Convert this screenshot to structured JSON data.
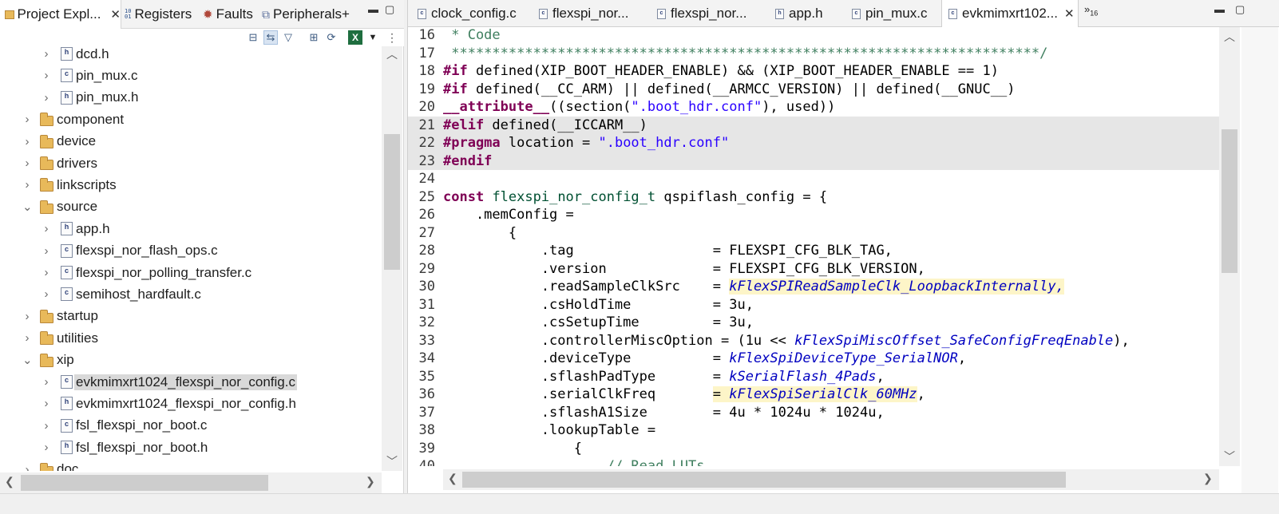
{
  "left_panel": {
    "tabs": [
      {
        "icon": "project-explorer-icon",
        "label": "Project Expl...",
        "close": "✕"
      },
      {
        "icon": "registers-icon",
        "label": "Registers"
      },
      {
        "icon": "faults-icon",
        "label": "Faults"
      },
      {
        "icon": "peripherals-icon",
        "label": "Peripherals+"
      }
    ],
    "toolbar": [
      "collapse-all-icon",
      "link-with-editor-icon",
      "filter-icon",
      "layout-icon",
      "refresh-icon",
      "excel-icon",
      "view-menu-icon",
      "more-icon"
    ],
    "tree": [
      {
        "label": "dcd.h",
        "kind": "h",
        "glyph": "h"
      },
      {
        "label": "pin_mux.c",
        "kind": "c",
        "glyph": "c"
      },
      {
        "label": "pin_mux.h",
        "kind": "h",
        "glyph": "h"
      },
      {
        "label": "component",
        "kind": "folder"
      },
      {
        "label": "device",
        "kind": "folder"
      },
      {
        "label": "drivers",
        "kind": "folder"
      },
      {
        "label": "linkscripts",
        "kind": "folder"
      },
      {
        "label": "source",
        "kind": "folder"
      },
      {
        "label": "app.h",
        "kind": "h",
        "glyph": "h"
      },
      {
        "label": "flexspi_nor_flash_ops.c",
        "kind": "c",
        "glyph": "c"
      },
      {
        "label": "flexspi_nor_polling_transfer.c",
        "kind": "c",
        "glyph": "c"
      },
      {
        "label": "semihost_hardfault.c",
        "kind": "c",
        "glyph": "c"
      },
      {
        "label": "startup",
        "kind": "folder"
      },
      {
        "label": "utilities",
        "kind": "folder"
      },
      {
        "label": "xip",
        "kind": "folder"
      },
      {
        "label": "evkmimxrt1024_flexspi_nor_config.c",
        "kind": "c",
        "glyph": "c"
      },
      {
        "label": "evkmimxrt1024_flexspi_nor_config.h",
        "kind": "h",
        "glyph": "h"
      },
      {
        "label": "fsl_flexspi_nor_boot.c",
        "kind": "c",
        "glyph": "c"
      },
      {
        "label": "fsl_flexspi_nor_boot.h",
        "kind": "h",
        "glyph": "h"
      },
      {
        "label": "doc",
        "kind": "folder"
      }
    ]
  },
  "editor": {
    "tabs": [
      {
        "label": "clock_config.c",
        "glyph": "c"
      },
      {
        "label": "flexspi_nor...",
        "glyph": "c"
      },
      {
        "label": "flexspi_nor...",
        "glyph": "c"
      },
      {
        "label": "app.h",
        "glyph": "h"
      },
      {
        "label": "pin_mux.c",
        "glyph": "c"
      },
      {
        "label": "evkmimxrt102...",
        "glyph": "c",
        "close": "✕"
      }
    ],
    "more_tabs": {
      "symbol": "»",
      "count": "16"
    },
    "lines": [
      {
        "n": "16",
        "hl": false,
        "t": [
          [
            " * Code",
            "cmt"
          ]
        ]
      },
      {
        "n": "17",
        "hl": false,
        "t": [
          [
            " ************************************************************************/",
            "cmt"
          ]
        ]
      },
      {
        "n": "18",
        "hl": false,
        "t": [
          [
            "#if",
            "kw"
          ],
          [
            " defined(XIP_BOOT_HEADER_ENABLE) && (XIP_BOOT_HEADER_ENABLE == 1)",
            ""
          ]
        ]
      },
      {
        "n": "19",
        "hl": false,
        "t": [
          [
            "#if",
            "kw"
          ],
          [
            " defined(__CC_ARM) || defined(__ARMCC_VERSION) || defined(__GNUC__)",
            ""
          ]
        ]
      },
      {
        "n": "20",
        "hl": false,
        "t": [
          [
            "__attribute__",
            "kw"
          ],
          [
            "((section(",
            ""
          ],
          [
            "\".boot_hdr.conf\"",
            "str"
          ],
          [
            "), used))",
            ""
          ]
        ]
      },
      {
        "n": "21",
        "hl": true,
        "t": [
          [
            "#elif",
            "kw"
          ],
          [
            " defined(__ICCARM__)",
            ""
          ]
        ]
      },
      {
        "n": "22",
        "hl": true,
        "t": [
          [
            "#pragma",
            "kw"
          ],
          [
            " location = ",
            ""
          ],
          [
            "\".boot_hdr.conf\"",
            "str"
          ]
        ]
      },
      {
        "n": "23",
        "hl": true,
        "t": [
          [
            "#endif",
            "kw"
          ]
        ]
      },
      {
        "n": "24",
        "hl": false,
        "t": [
          [
            "",
            ""
          ]
        ]
      },
      {
        "n": "25",
        "hl": false,
        "t": [
          [
            "const",
            "kw"
          ],
          [
            " ",
            ""
          ],
          [
            "flexspi_nor_config_t",
            "typ"
          ],
          [
            " qspiflash_config = {",
            ""
          ]
        ]
      },
      {
        "n": "26",
        "hl": false,
        "t": [
          [
            "    .memConfig =",
            ""
          ]
        ]
      },
      {
        "n": "27",
        "hl": false,
        "t": [
          [
            "        {",
            ""
          ]
        ]
      },
      {
        "n": "28",
        "hl": false,
        "t": [
          [
            "            .tag                 = FLEXSPI_CFG_BLK_TAG,",
            ""
          ]
        ]
      },
      {
        "n": "29",
        "hl": false,
        "t": [
          [
            "            .version             = FLEXSPI_CFG_BLK_VERSION,",
            ""
          ]
        ]
      },
      {
        "n": "30",
        "hl": false,
        "t": [
          [
            "            .readSampleClkSrc    = ",
            ""
          ],
          [
            "kFlexSPIReadSampleClk_LoopbackInternally,",
            "en occ"
          ]
        ]
      },
      {
        "n": "31",
        "hl": false,
        "t": [
          [
            "            .csHoldTime          = 3u,",
            ""
          ]
        ]
      },
      {
        "n": "32",
        "hl": false,
        "t": [
          [
            "            .csSetupTime         = 3u,",
            ""
          ]
        ]
      },
      {
        "n": "33",
        "hl": false,
        "t": [
          [
            "            .controllerMiscOption = (1u << ",
            ""
          ],
          [
            "kFlexSpiMiscOffset_SafeConfigFreqEnable",
            "en"
          ],
          [
            "),",
            ""
          ]
        ]
      },
      {
        "n": "34",
        "hl": false,
        "t": [
          [
            "            .deviceType          = ",
            ""
          ],
          [
            "kFlexSpiDeviceType_SerialNOR",
            "en"
          ],
          [
            ",",
            ""
          ]
        ]
      },
      {
        "n": "35",
        "hl": false,
        "t": [
          [
            "            .sflashPadType       = ",
            ""
          ],
          [
            "kSerialFlash_4Pads",
            "en"
          ],
          [
            ",",
            ""
          ]
        ]
      },
      {
        "n": "36",
        "hl": false,
        "t": [
          [
            "            .serialClkFreq       ",
            ""
          ],
          [
            "= ",
            "occ"
          ],
          [
            "kFlexSpiSerialClk_60MHz",
            "en occ"
          ],
          [
            ",",
            ""
          ]
        ]
      },
      {
        "n": "37",
        "hl": false,
        "t": [
          [
            "            .sflashA1Size        = 4u * 1024u * 1024u,",
            ""
          ]
        ]
      },
      {
        "n": "38",
        "hl": false,
        "t": [
          [
            "            .lookupTable =",
            ""
          ]
        ]
      },
      {
        "n": "39",
        "hl": false,
        "t": [
          [
            "                {",
            ""
          ]
        ]
      },
      {
        "n": "40",
        "hl": false,
        "t": [
          [
            "                    ",
            ""
          ],
          [
            "// Read LUTs",
            "cmt"
          ]
        ]
      }
    ]
  }
}
